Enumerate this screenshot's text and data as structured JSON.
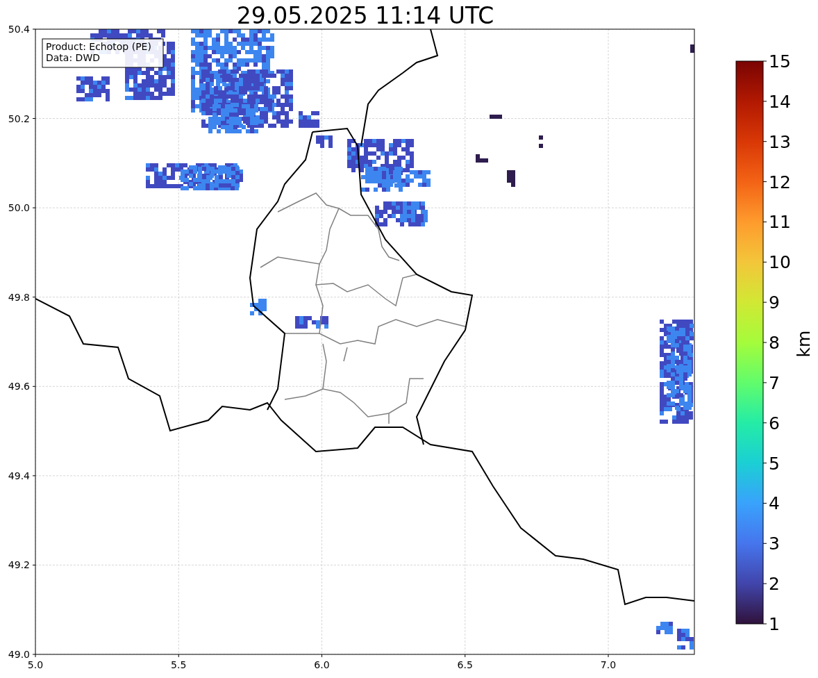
{
  "title": "29.05.2025 11:14 UTC",
  "info_box": [
    "Product: Echotop (PE)",
    "Data: DWD"
  ],
  "x_ticks": [
    "5.0",
    "5.5",
    "6.0",
    "6.5",
    "7.0"
  ],
  "y_ticks": [
    "50.4",
    "50.2",
    "50.0",
    "49.8",
    "49.6",
    "49.4",
    "49.2",
    "49.0"
  ],
  "colorbar": {
    "label": "km",
    "ticks": [
      "15",
      "14",
      "13",
      "12",
      "11",
      "10",
      "9",
      "8",
      "7",
      "6",
      "5",
      "4",
      "3",
      "2",
      "1"
    ]
  }
}
